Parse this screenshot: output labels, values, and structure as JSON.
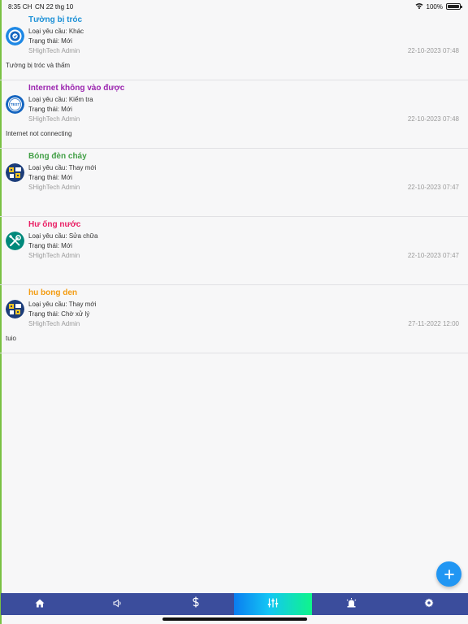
{
  "status_bar": {
    "time": "8:35 CH",
    "date": "CN 22 thg 10",
    "battery": "100%"
  },
  "requests": [
    {
      "title": "Tường bị tróc",
      "title_color": "#1a8fd6",
      "icon": "shield-check-icon",
      "type": "Loại yêu cầu: Khác",
      "status": "Trạng thái: Mới",
      "author": "SHighTech Admin",
      "datetime": "22-10-2023 07:48",
      "description": "Tường bị tróc và thấm"
    },
    {
      "title": "Internet không vào được",
      "title_color": "#9c27b0",
      "icon": "test-badge-icon",
      "type": "Loại yêu cầu: Kiểm tra",
      "status": "Trạng thái: Mới",
      "author": "SHighTech Admin",
      "datetime": "22-10-2023 07:48",
      "description": "Internet not connecting"
    },
    {
      "title": "Bóng đèn cháy",
      "title_color": "#43a047",
      "icon": "replace-parts-icon",
      "type": "Loại yêu cầu: Thay mới",
      "status": "Trạng thái: Mới",
      "author": "SHighTech Admin",
      "datetime": "22-10-2023 07:47",
      "description": ""
    },
    {
      "title": "Hư ống nước",
      "title_color": "#e91e63",
      "icon": "wrench-screwdriver-icon",
      "type": "Loại yêu cầu: Sửa chữa",
      "status": "Trạng thái: Mới",
      "author": "SHighTech Admin",
      "datetime": "22-10-2023 07:47",
      "description": ""
    },
    {
      "title": "hu bong den",
      "title_color": "#f39c12",
      "icon": "replace-parts-icon",
      "type": "Loại yêu cầu: Thay mới",
      "status": "Trạng thái: Chờ xử lý",
      "author": "SHighTech Admin",
      "datetime": "27-11-2022 12:00",
      "description": "tuio"
    }
  ],
  "fab": {
    "icon": "plus-icon",
    "color": "#2196f3"
  },
  "bottom_nav": {
    "background": "#3b4d9c",
    "items": [
      {
        "icon": "home-icon",
        "active": false
      },
      {
        "icon": "speaker-icon",
        "active": false
      },
      {
        "icon": "dollar-icon",
        "active": false
      },
      {
        "icon": "sliders-icon",
        "active": true
      },
      {
        "icon": "alarm-icon",
        "active": false
      },
      {
        "icon": "gear-icon",
        "active": false
      }
    ]
  }
}
